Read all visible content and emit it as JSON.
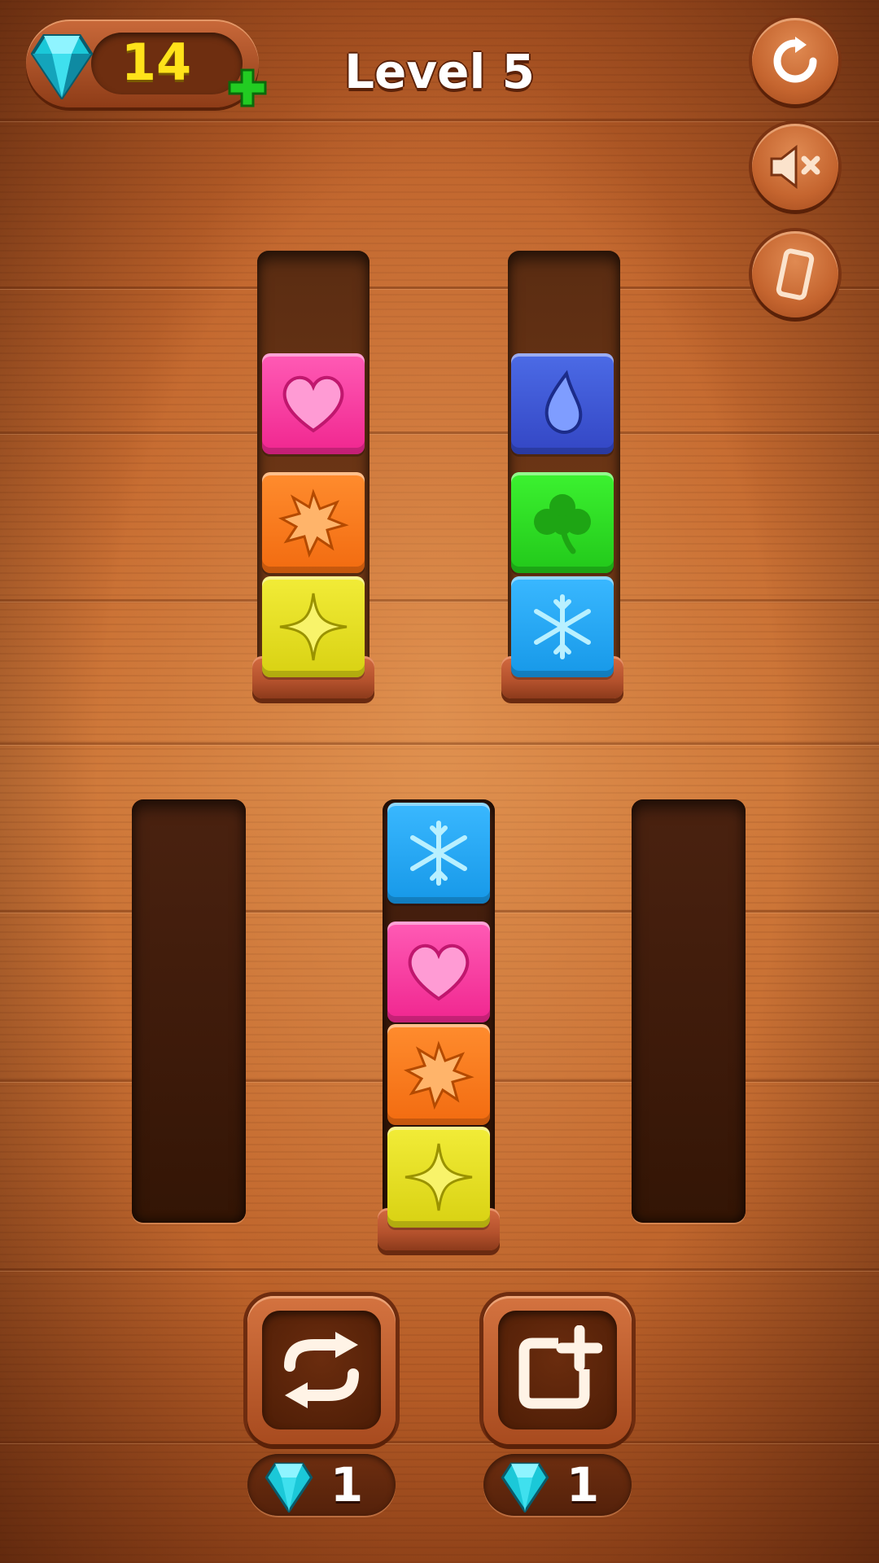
{
  "hud": {
    "gems": "14",
    "level": "Level 5"
  },
  "colors": {
    "pink": "#ff3fa6",
    "orange": "#ff7a1a",
    "yellow": "#e8e21c",
    "navy": "#3a55d8",
    "green": "#2ee024",
    "sky": "#22a8f4"
  },
  "tubes": [
    {
      "id": "top-left",
      "blocks": [
        "heart",
        "star-burst",
        "sparkle"
      ]
    },
    {
      "id": "top-right",
      "blocks": [
        "drop",
        "clover",
        "snowflake"
      ]
    },
    {
      "id": "bottom-left",
      "blocks": []
    },
    {
      "id": "bottom-middle",
      "blocks": [
        "snowflake",
        "heart",
        "star-burst",
        "sparkle"
      ]
    },
    {
      "id": "bottom-right",
      "blocks": []
    }
  ],
  "icons": {
    "restart": "restart-icon",
    "mute": "sound-muted-icon",
    "vibration": "vibration-icon",
    "shuffle": "shuffle-icon",
    "add_tube": "add-tube-icon",
    "gem": "gem-icon"
  },
  "boosters": {
    "shuffle_cost": "1",
    "add_tube_cost": "1"
  }
}
